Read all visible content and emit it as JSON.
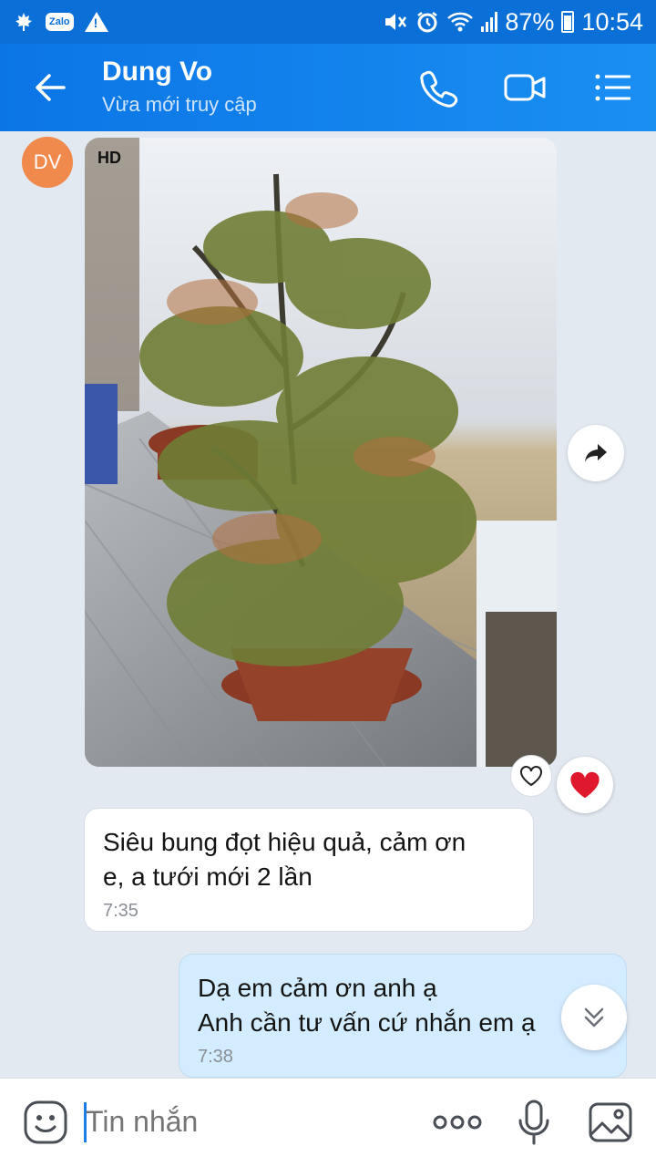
{
  "status_bar": {
    "battery": "87%",
    "time": "10:54",
    "zalo_label": "Zalo"
  },
  "header": {
    "contact_name": "Dung Vo",
    "status": "Vừa mới truy cập"
  },
  "messages": {
    "avatar_initials": "DV",
    "photo_badge": "HD",
    "incoming_text_1": "Siêu bung đọt hiệu quả, cảm ơn",
    "incoming_text_2": "e, a tưới mới 2 lần",
    "incoming_time": "7:35",
    "outgoing_text_1": "Dạ em cảm ơn anh ạ",
    "outgoing_text_2": "Anh cần tư vấn cứ nhắn em ạ",
    "outgoing_time": "7:38"
  },
  "input_bar": {
    "placeholder": "Tin nhắn"
  },
  "colors": {
    "header": "#0b75e6",
    "outgoing_bubble": "#d4ecff",
    "heart": "#e0182d"
  }
}
